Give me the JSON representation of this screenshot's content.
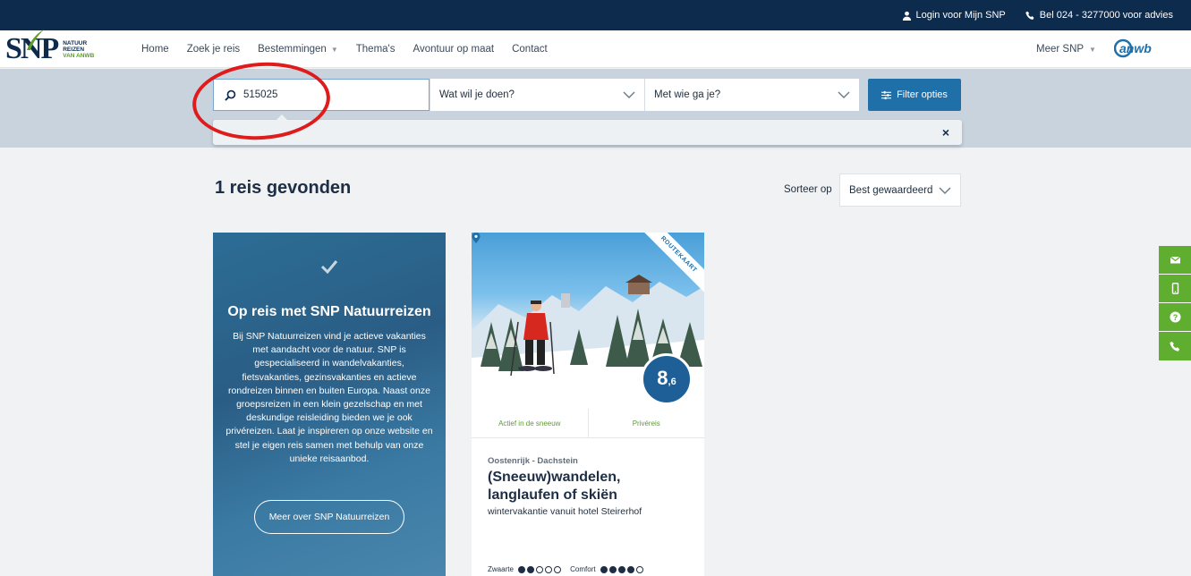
{
  "topbar": {
    "login": "Login voor Mijn SNP",
    "phone": "Bel 024 - 3277000 voor advies"
  },
  "logo": {
    "brand": "SNP",
    "line1": "NATUUR",
    "line2": "REIZEN",
    "line3": "VAN ANWB",
    "partner": "anwb"
  },
  "nav": {
    "items": [
      "Home",
      "Zoek je reis",
      "Bestemmingen",
      "Thema's",
      "Avontuur op maat",
      "Contact"
    ],
    "meer": "Meer SNP"
  },
  "search": {
    "query": "515025",
    "activity": "Wat wil je doen?",
    "company": "Met wie ga je?",
    "filter_label": "Filter opties",
    "close": "×"
  },
  "results": {
    "title": "1 reis gevonden",
    "sort_label": "Sorteer op",
    "sort_value": "Best gewaardeerd"
  },
  "promo": {
    "title": "Op reis met SNP Natuurreizen",
    "text": "Bij SNP Natuurreizen vind je actieve vakanties met aandacht voor de natuur. SNP is gespecialiseerd in wandelvakanties, fietsvakanties, gezinsvakanties en actieve rondreizen binnen en buiten Europa. Naast onze groepsreizen in een klein gezelschap en met deskundige reisleiding bieden we je ook privéreizen. Laat je inspireren op onze website en stel je eigen reis samen met behulp van onze unieke reisaanbod.",
    "button": "Meer over SNP Natuurreizen"
  },
  "trip": {
    "ribbon": "ROUTEKAART",
    "rating_int": "8",
    "rating_dec": ",6",
    "tag1": "Actief in de sneeuw",
    "tag2": "Privéreis",
    "location": "Oostenrijk - Dachstein",
    "title": "(Sneeuw)wandelen, langlaufen of skiën",
    "subtitle": "wintervakantie vanuit hotel Steirerhof",
    "zwaarte_label": "Zwaarte",
    "zwaarte": 2,
    "comfort_label": "Comfort",
    "comfort": 4,
    "dots_max": 5
  },
  "colors": {
    "navy": "#0d2b4d",
    "blue": "#1f6fa8",
    "green": "#5fae30",
    "highlight": "#e01b1b"
  },
  "side_buttons": [
    "mail-icon",
    "mobile-icon",
    "help-icon",
    "phone-icon"
  ]
}
